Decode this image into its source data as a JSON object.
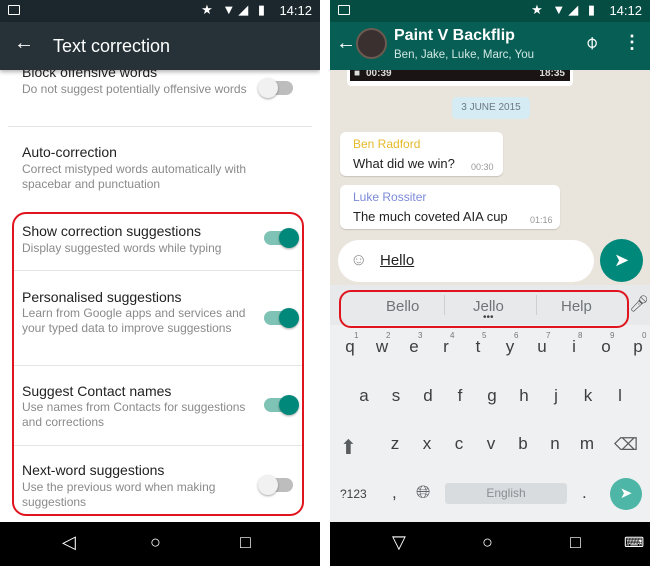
{
  "left": {
    "status_time": "14:12",
    "toolbar_title": "Text correction",
    "items": [
      {
        "title": "Block offensive words",
        "subtitle": "Do not suggest potentially offensive words",
        "toggle": false
      },
      {
        "title": "Auto-correction",
        "subtitle": "Correct mistyped words automatically with spacebar and punctuation"
      },
      {
        "title": "Show correction suggestions",
        "subtitle": "Display suggested words while typing",
        "toggle": true
      },
      {
        "title": "Personalised suggestions",
        "subtitle": "Learn from Google apps and services and your typed data to improve suggestions",
        "toggle": true
      },
      {
        "title": "Suggest Contact names",
        "subtitle": "Use names from Contacts for suggestions and corrections",
        "toggle": true
      },
      {
        "title": "Next-word suggestions",
        "subtitle": "Use the previous word when making suggestions",
        "toggle": false
      }
    ]
  },
  "right": {
    "status_time": "14:12",
    "chat_title": "Paint V Backflip",
    "chat_members": "Ben, Jake, Luke, Marc, You",
    "video_duration": "00:39",
    "video_time": "18:35",
    "date_label": "3 JUNE 2015",
    "messages": [
      {
        "sender": "Ben Radford",
        "text": "What did we win?",
        "time": "00:30",
        "sender_color": "#e5b92a"
      },
      {
        "sender": "Luke Rossiter",
        "text": "The much coveted AIA cup",
        "time": "01:16",
        "sender_color": "#7b8ad8"
      }
    ],
    "input_value": "Hello",
    "suggestions": [
      "Bello",
      "Jello",
      "Help"
    ],
    "keyboard": {
      "row1": [
        "q",
        "w",
        "e",
        "r",
        "t",
        "y",
        "u",
        "i",
        "o",
        "p"
      ],
      "row1_numbers": [
        "1",
        "2",
        "3",
        "4",
        "5",
        "6",
        "7",
        "8",
        "9",
        "0"
      ],
      "row2": [
        "a",
        "s",
        "d",
        "f",
        "g",
        "h",
        "j",
        "k",
        "l"
      ],
      "row3": [
        "z",
        "x",
        "c",
        "v",
        "b",
        "n",
        "m"
      ],
      "symbols": "?123",
      "comma": ",",
      "space": "English",
      "period": "."
    }
  },
  "colors": {
    "accent": "#00897b",
    "whatsapp_header": "#075e54",
    "highlight": "#e0141e",
    "send": "#4db6a6"
  }
}
